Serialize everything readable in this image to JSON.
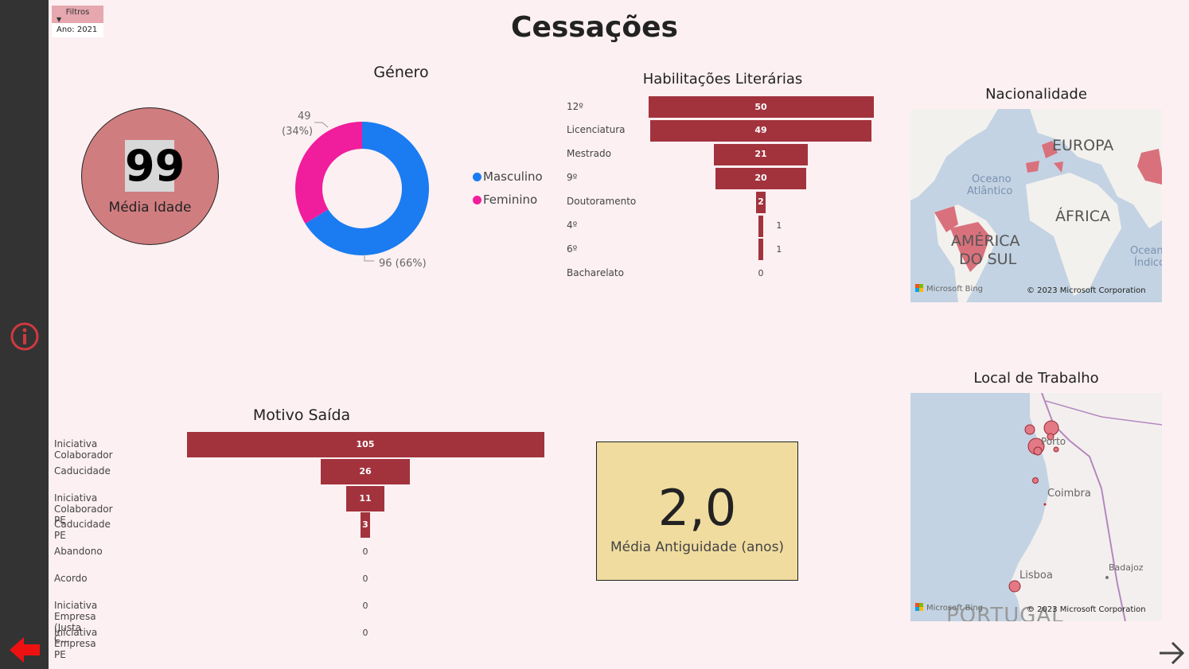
{
  "page": {
    "title": "Cessações",
    "filters": {
      "header": "Filtros",
      "value": "Ano: 2021"
    }
  },
  "age_card": {
    "value": "99",
    "label": "Média Idade"
  },
  "genero": {
    "title": "Género",
    "legend": [
      {
        "label": "Masculino",
        "color": "#1a7cf0"
      },
      {
        "label": "Feminino",
        "color": "#f01d9c"
      }
    ],
    "labels": {
      "feminino_count": "49",
      "feminino_pct": "(34%)",
      "masculino": "96 (66%)"
    }
  },
  "habilitacoes": {
    "title": "Habilitações Literárias"
  },
  "motivo": {
    "title": "Motivo Saída"
  },
  "antiguidade": {
    "value": "2,0",
    "label": "Média Antiguidade (anos)"
  },
  "nacionalidade": {
    "title": "Nacionalidade",
    "map_labels": {
      "europa": "EUROPA",
      "oceano1": "Oceano",
      "oceano2": "Atlântico",
      "africa": "ÁFRICA",
      "america1": "AMÉRICA",
      "america2": "DO SUL",
      "indico1": "Oceano",
      "indico2": "Índico"
    },
    "bing": "Microsoft Bing",
    "copyright": "© 2023 Microsoft Corporation"
  },
  "local": {
    "title": "Local de Trabalho",
    "map_labels": {
      "porto": "Porto",
      "coimbra": "Coimbra",
      "lisboa": "Lisboa",
      "badajoz": "Badajoz",
      "portugal": "PORTUGAL"
    },
    "bing": "Microsoft Bing",
    "copyright": "© 2023 Microsoft Corporation"
  },
  "chart_data": [
    {
      "type": "pie",
      "title": "Género",
      "categories": [
        "Masculino",
        "Feminino"
      ],
      "values": [
        96,
        49
      ],
      "percent": [
        66,
        34
      ],
      "donut": true
    },
    {
      "type": "bar",
      "title": "Habilitações Literárias",
      "categories": [
        "12º",
        "Licenciatura",
        "Mestrado",
        "9º",
        "Doutoramento",
        "4º",
        "6º",
        "Bacharelato"
      ],
      "values": [
        50,
        49,
        21,
        20,
        2,
        1,
        1,
        0
      ],
      "orientation": "horizontal-funnel"
    },
    {
      "type": "bar",
      "title": "Motivo Saída",
      "categories": [
        "Iniciativa Colaborador",
        "Caducidade",
        "Iniciativa Colaborador PE",
        "Caducidade PE",
        "Abandono",
        "Acordo",
        "Iniciativa Empresa (Justa C...",
        "Iniciativa Empresa PE"
      ],
      "values": [
        105,
        26,
        11,
        3,
        0,
        0,
        0,
        0
      ],
      "orientation": "horizontal-funnel"
    }
  ]
}
